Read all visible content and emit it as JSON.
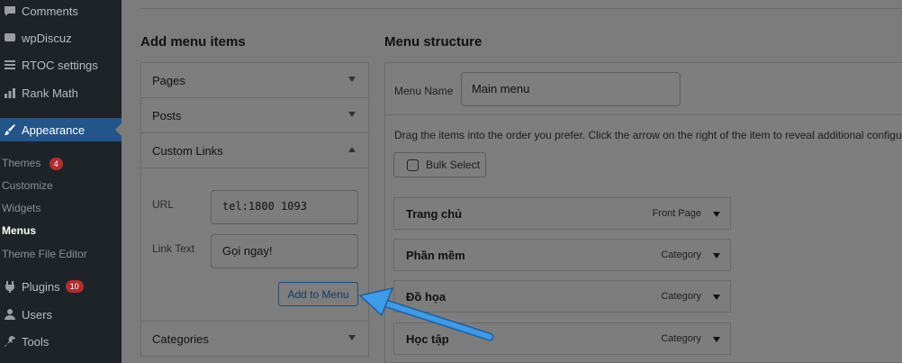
{
  "sidebar": {
    "comments": "Comments",
    "wpdiscuz": "wpDiscuz",
    "rtoc": "RTOC settings",
    "rankmath": "Rank Math",
    "appearance": "Appearance",
    "themes": "Themes",
    "themes_badge": "4",
    "customize": "Customize",
    "widgets": "Widgets",
    "menus": "Menus",
    "theme_file_editor": "Theme File Editor",
    "plugins": "Plugins",
    "plugins_badge": "10",
    "users": "Users",
    "tools": "Tools"
  },
  "add_items": {
    "heading": "Add menu items",
    "pages": "Pages",
    "posts": "Posts",
    "custom_links": "Custom Links",
    "url_label": "URL",
    "url_value": "tel:1800 1093",
    "link_text_label": "Link Text",
    "link_text_value": "Gọi ngay!",
    "add_button": "Add to Menu",
    "categories": "Categories"
  },
  "structure": {
    "heading": "Menu structure",
    "menu_name_label": "Menu Name",
    "menu_name_value": "Main menu",
    "instructions": "Drag the items into the order you prefer. Click the arrow on the right of the item to reveal additional configuration options.",
    "bulk_select": "Bulk Select",
    "items": [
      {
        "title": "Trang chủ",
        "type": "Front Page"
      },
      {
        "title": "Phần mềm",
        "type": "Category"
      },
      {
        "title": "Đồ họa",
        "type": "Category"
      },
      {
        "title": "Học tập",
        "type": "Category"
      }
    ]
  },
  "colors": {
    "sidebar_bg": "#1d2327",
    "active_menu": "#22558a",
    "badge": "#b32d2e",
    "pointer_arrow": "#3d9be9"
  }
}
